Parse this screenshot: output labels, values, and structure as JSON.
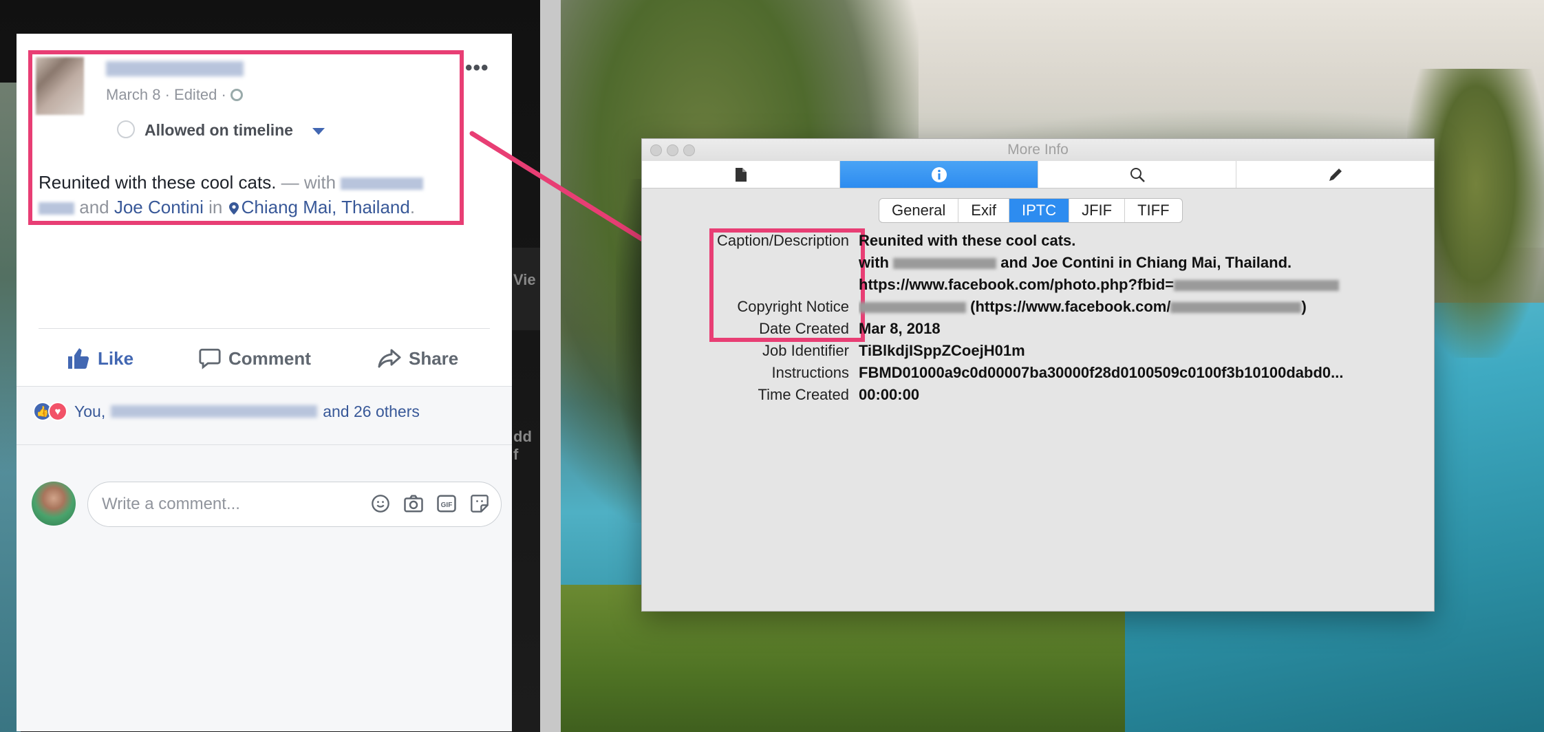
{
  "facebook_post": {
    "date_line": "March 8 · Edited ·",
    "timeline_label": "Allowed on timeline",
    "post_text_main": "Reunited with these cool cats.",
    "post_with": " — with ",
    "post_and": "and ",
    "tagged_friend": "Joe Contini",
    "post_in": " in ",
    "location": "Chiang Mai, Thailand",
    "post_end": ".",
    "actions": {
      "like": "Like",
      "comment": "Comment",
      "share": "Share"
    },
    "reactions": {
      "prefix": "You,",
      "suffix": "and 26 others"
    },
    "comment_placeholder": "Write a comment...",
    "comment_icons": [
      "smiley-icon",
      "camera-icon",
      "gif-icon",
      "sticker-icon"
    ]
  },
  "background_labels": {
    "view": "Vie",
    "add": "dd f"
  },
  "more_info_window": {
    "title": "More Info",
    "toolbar_tabs": [
      "document-icon",
      "info-icon",
      "search-icon",
      "pencil-icon"
    ],
    "active_toolbar_tab": "info-icon",
    "segments": [
      "General",
      "Exif",
      "IPTC",
      "JFIF",
      "TIFF"
    ],
    "active_segment": "IPTC",
    "metadata": {
      "caption_label": "Caption/Description",
      "caption_line1": "Reunited with these cool cats.",
      "caption_line2_prefix": "with",
      "caption_line2_suffix": "and Joe Contini in Chiang Mai, Thailand.",
      "caption_line3_prefix": "https://www.facebook.com/photo.php?fbid=",
      "copyright_label": "Copyright Notice",
      "copyright_mid": "(https://www.facebook.com/",
      "copyright_end": ")",
      "date_label": "Date Created",
      "date_value": "Mar 8, 2018",
      "job_label": "Job Identifier",
      "job_value": "TiBlkdjISppZCoejH01m",
      "instructions_label": "Instructions",
      "instructions_value": "FBMD01000a9c0d00007ba30000f28d0100509c0100f3b10100dabd0...",
      "time_label": "Time Created",
      "time_value": "00:00:00"
    }
  },
  "colors": {
    "highlight": "#e83e74",
    "facebook_blue": "#4267b2",
    "mac_selected": "#2d8cf0"
  }
}
